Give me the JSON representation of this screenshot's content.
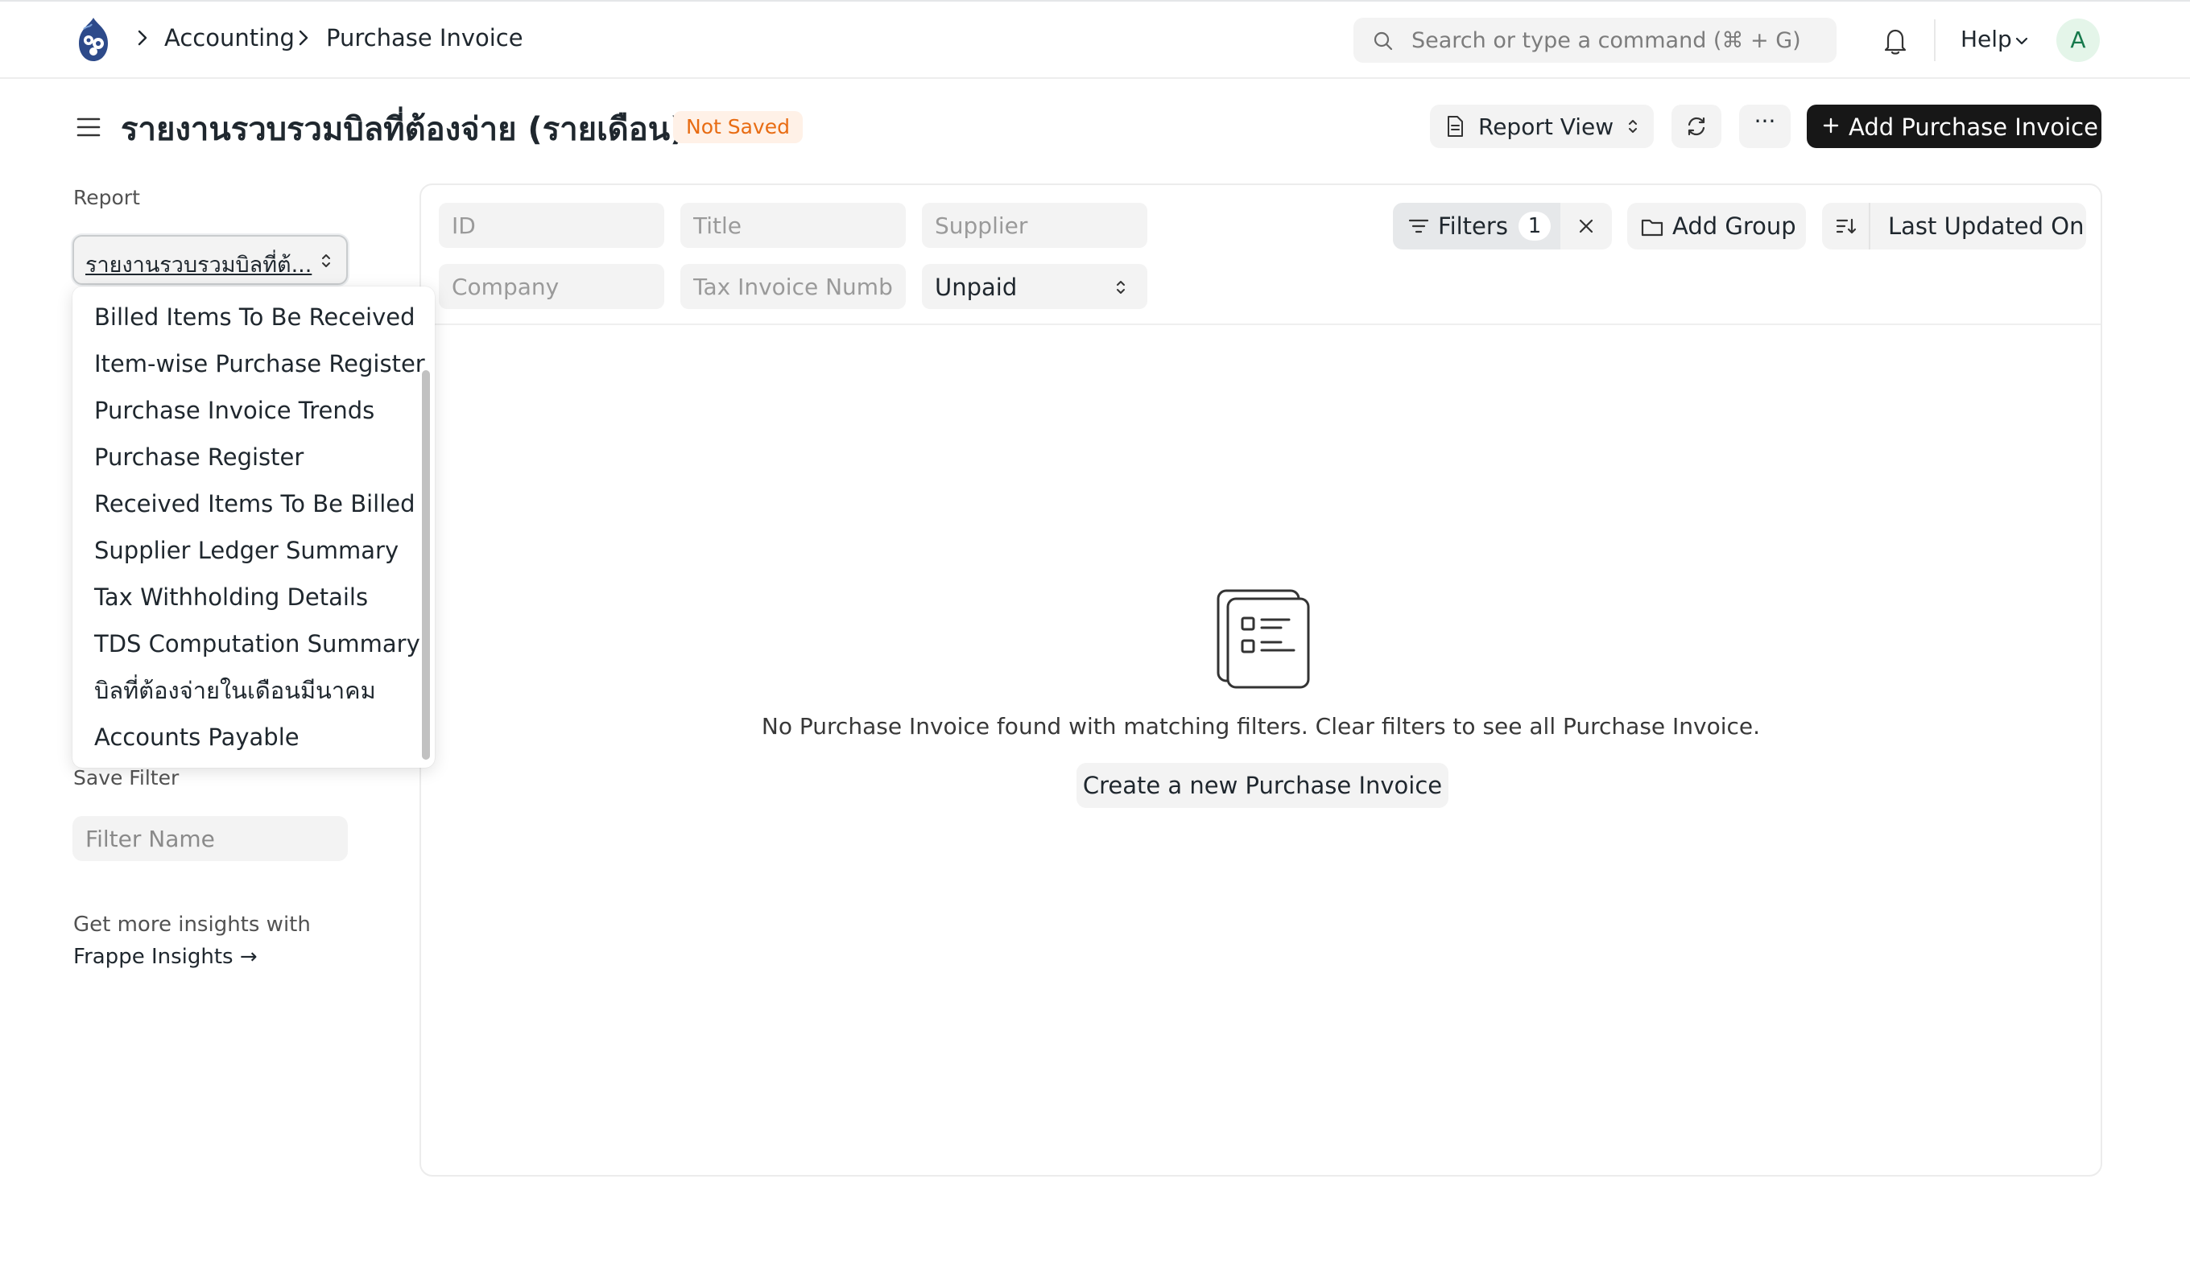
{
  "navbar": {
    "breadcrumbs": [
      "Accounting",
      "Purchase Invoice"
    ],
    "search_placeholder": "Search or type a command (⌘ + G)",
    "help_label": "Help",
    "avatar_initial": "A"
  },
  "page": {
    "title": "รายงานรวบรวมบิลที่ต้องจ่าย (รายเดือน)",
    "status_badge": "Not Saved",
    "report_view_label": "Report View",
    "more_label": "···",
    "primary_action_label": "Add Purchase Invoice"
  },
  "sidebar": {
    "report_label": "Report",
    "report_selected": "รายงานรวบรวมบิลที่ต้...",
    "report_options": [
      "Billed Items To Be Received",
      "Item-wise Purchase Register",
      "Purchase Invoice Trends",
      "Purchase Register",
      "Received Items To Be Billed",
      "Supplier Ledger Summary",
      "Tax Withholding Details",
      "TDS Computation Summary",
      "บิลที่ต้องจ่ายในเดือนมีนาคม",
      "Accounts Payable"
    ],
    "save_filter_label": "Save Filter",
    "filter_name_placeholder": "Filter Name",
    "insights_text": "Get more insights with",
    "insights_link": "Frappe Insights →"
  },
  "filters": {
    "id_placeholder": "ID",
    "title_placeholder": "Title",
    "supplier_placeholder": "Supplier",
    "company_placeholder": "Company",
    "tax_invoice_placeholder": "Tax Invoice Numb",
    "status_value": "Unpaid",
    "filters_label": "Filters",
    "filters_count": "1",
    "add_group_label": "Add Group",
    "sort_label": "Last Updated On"
  },
  "empty_state": {
    "message": "No Purchase Invoice found with matching filters. Clear filters to see all Purchase Invoice.",
    "create_label": "Create a new Purchase Invoice"
  },
  "colors": {
    "primary_button": "#171717",
    "badge_bg": "#fff1e7",
    "badge_text": "#e86c13",
    "avatar_bg": "#e4f5e9",
    "avatar_text": "#16794c"
  }
}
